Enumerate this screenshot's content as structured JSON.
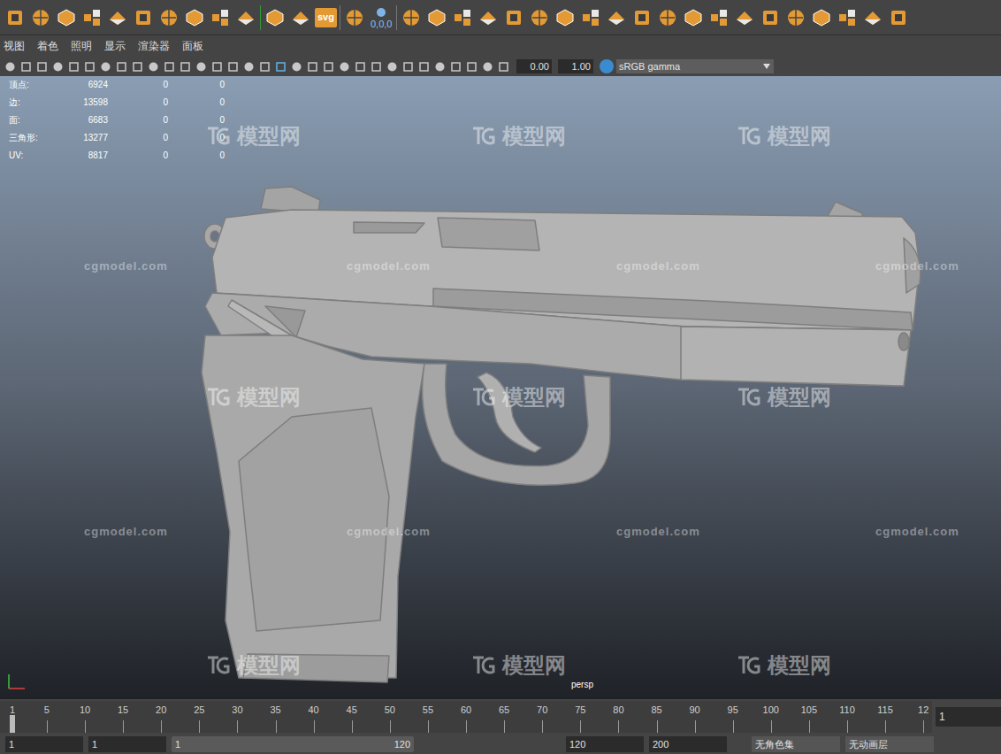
{
  "shelf": {
    "svg_label": "svg",
    "coords": "0,0,0"
  },
  "menu": [
    "视图",
    "着色",
    "照明",
    "显示",
    "渲染器",
    "面板"
  ],
  "panel_toolbar": {
    "fields": [
      "0.00",
      "1.00"
    ],
    "color_space": "sRGB gamma"
  },
  "hud": {
    "rows": [
      {
        "label": "顶点:",
        "values": [
          "6924",
          "0",
          "0"
        ]
      },
      {
        "label": "边:",
        "values": [
          "13598",
          "0",
          "0"
        ]
      },
      {
        "label": "面:",
        "values": [
          "6683",
          "0",
          "0"
        ]
      },
      {
        "label": "三角形:",
        "values": [
          "13277",
          "0",
          "0"
        ]
      },
      {
        "label": "UV:",
        "values": [
          "8817",
          "0",
          "0"
        ]
      }
    ]
  },
  "viewport": {
    "camera": "persp"
  },
  "watermark": {
    "logo": "模型网",
    "url": "cgmodel.com"
  },
  "timeline": {
    "ticks": [
      "1",
      "5",
      "10",
      "15",
      "20",
      "25",
      "30",
      "35",
      "40",
      "45",
      "50",
      "55",
      "60",
      "65",
      "70",
      "75",
      "80",
      "85",
      "90",
      "95",
      "100",
      "105",
      "110",
      "115",
      "12"
    ],
    "current": "1"
  },
  "range": {
    "fields": [
      "1",
      "1"
    ],
    "slider_start": "1",
    "slider_end": "120",
    "end_fields": [
      "120",
      "200"
    ],
    "character_set": "无角色集",
    "anim_layer": "无动画层"
  }
}
